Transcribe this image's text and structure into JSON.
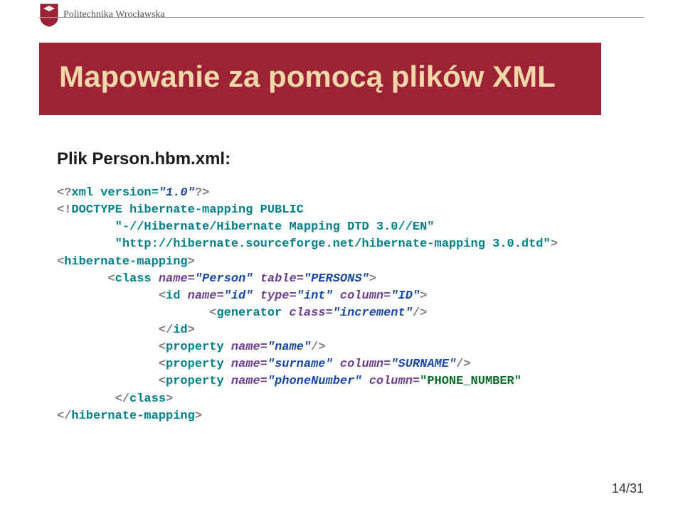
{
  "header": {
    "university": "Politechnika Wrocławska"
  },
  "title": "Mapowanie za pomocą plików XML",
  "subtitle": "Plik Person.hbm.xml:",
  "code": {
    "l1a": "<?",
    "l1b": "xml version=",
    "l1c": "\"1.0\"",
    "l1d": "?>",
    "l2a": "<!",
    "l2b": "DOCTYPE hibernate-mapping PUBLIC",
    "l3": "        \"-//Hibernate/Hibernate Mapping DTD 3.0//EN\"",
    "l4a": "        \"http://hibernate.sourceforge.net/hibernate-mapping 3.0.dtd\"",
    "l4b": ">",
    "l5a": "<",
    "l5b": "hibernate-mapping",
    "l5c": ">",
    "l6a": "       <",
    "l6b": "class ",
    "l6c": "name=",
    "l6d": "\"Person\" ",
    "l6e": "table=",
    "l6f": "\"PERSONS\"",
    "l6g": ">",
    "l7a": "              <",
    "l7b": "id ",
    "l7c": "name=",
    "l7d": "\"id\" ",
    "l7e": "type=",
    "l7f": "\"int\" ",
    "l7g": "column=",
    "l7h": "\"ID\"",
    "l7i": ">",
    "l8a": "                     <",
    "l8b": "generator ",
    "l8c": "class=",
    "l8d": "\"increment\"",
    "l8e": "/>",
    "l9a": "              </",
    "l9b": "id",
    "l9c": ">",
    "l10a": "              <",
    "l10b": "property ",
    "l10c": "name=",
    "l10d": "\"name\"",
    "l10e": "/>",
    "l11a": "              <",
    "l11b": "property ",
    "l11c": "name=",
    "l11d": "\"surname\" ",
    "l11e": "column=",
    "l11f": "\"SURNAME\"",
    "l11g": "/>",
    "l12a": "              <",
    "l12b": "property ",
    "l12c": "name=",
    "l12d": "\"phoneNumber\" ",
    "l12e": "column=",
    "l12f": "\"PHONE_NUMBER\"",
    "l13a": "        </",
    "l13b": "class",
    "l13c": ">",
    "l14a": "</",
    "l14b": "hibernate-mapping",
    "l14c": ">"
  },
  "page": "14/31"
}
